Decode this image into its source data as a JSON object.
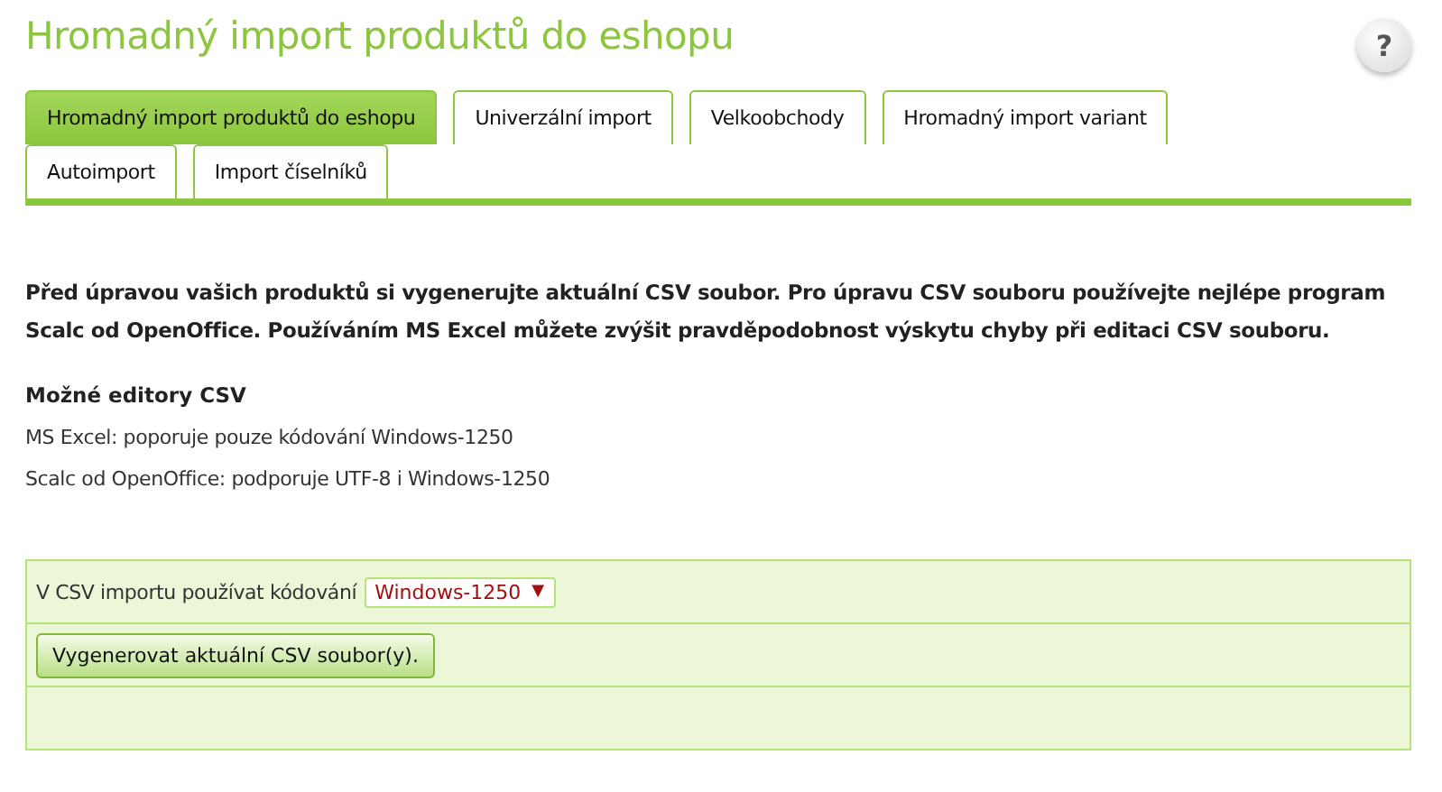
{
  "title": "Hromadný import produktů do eshopu",
  "help": {
    "label": "?"
  },
  "tabs": [
    {
      "label": "Hromadný import produktů do eshopu",
      "selected": true
    },
    {
      "label": "Univerzální import",
      "selected": false
    },
    {
      "label": "Velkoobchody",
      "selected": false
    },
    {
      "label": "Hromadný import variant",
      "selected": false
    },
    {
      "label": "Autoimport",
      "selected": false
    },
    {
      "label": "Import číselníků",
      "selected": false
    }
  ],
  "intro": "Před úpravou vašich produktů si vygenerujte aktuální CSV soubor. Pro úpravu CSV souboru používejte nejlépe program Scalc od OpenOffice. Používáním MS Excel můžete zvýšit pravděpodobnost výskytu chyby při editaci CSV souboru.",
  "editors": {
    "heading": "Možné editory CSV",
    "items": [
      "MS Excel: poporuje pouze kódování Windows-1250",
      "Scalc od OpenOffice: podporuje UTF-8 i Windows-1250"
    ]
  },
  "form": {
    "encoding_label": "V CSV importu používat kódování",
    "encoding": {
      "value": "Windows-1250",
      "caret": "▼"
    },
    "generate_button": "Vygenerovat aktuální CSV soubor(y)."
  }
}
